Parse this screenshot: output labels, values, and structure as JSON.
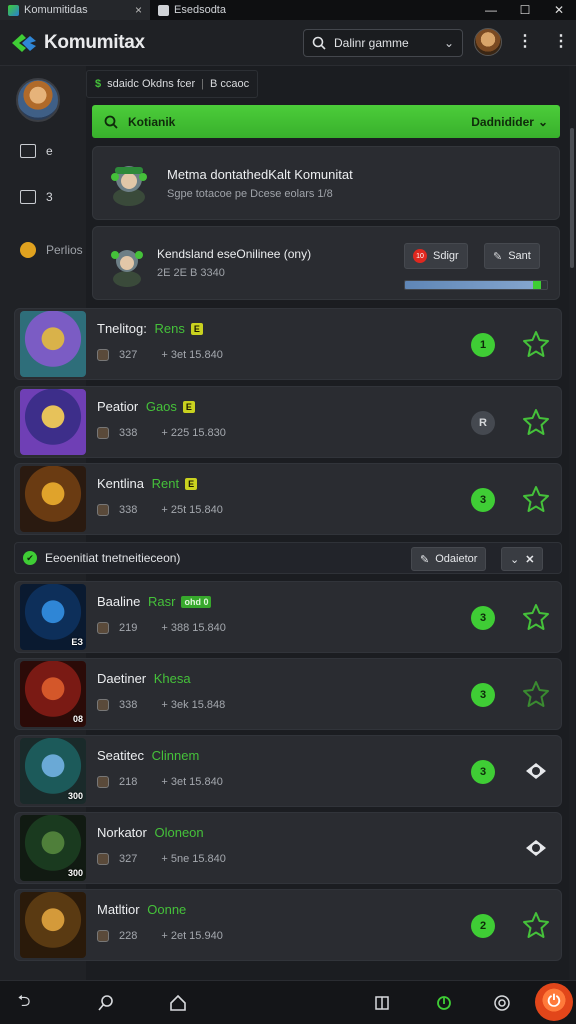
{
  "window": {
    "tab_active": "Komumitidas",
    "tab_second": "Esedsodta",
    "close_tab": "×",
    "minimize": "—",
    "maximize": "☐",
    "close": "✕"
  },
  "header": {
    "app_name": "Komumitax",
    "search_value": "Dalinr gamme",
    "search_icon": "search-icon",
    "search_chevron": "chevron-down-icon"
  },
  "rail": {
    "item1_label": "e",
    "item2_label": "3",
    "item3_label": "Perlios"
  },
  "breadcrumb": {
    "icon_text": "$",
    "text": "sdaidc Okdns fcer",
    "sep": "|",
    "tail": "B  ccaoc"
  },
  "greenbar": {
    "left": "Kotianik",
    "right": "Dadnidider",
    "right_chevron": "⌄"
  },
  "community_card": {
    "title": "Metma dontathedKalt Komunitat",
    "subtitle": "Sgpe totacoe pe Dcese eolars 1/8"
  },
  "download_card": {
    "title": "Kendsland eseOnilinee (ony)",
    "meta": "2E 2E B 3340",
    "btn_start_icon": "10",
    "btn_start": "Sdigr",
    "btn_edit": "Sant",
    "progress": 0.96
  },
  "colors": {
    "accent": "#45c13a",
    "tag_yellow": "#c9d21f",
    "fab": "#e2461a"
  },
  "games_top": [
    {
      "title": "Tnelitog:",
      "accent": "Rens",
      "tag": "E",
      "meta1": "327",
      "meta2": "+ 3et 15.840",
      "status": "1",
      "status_style": "green"
    },
    {
      "title": "Peatior",
      "accent": "Gaos",
      "tag": "E",
      "meta1": "338",
      "meta2": "+ 225 15.830",
      "status": "R",
      "status_style": "grey"
    },
    {
      "title": "Kentlina",
      "accent": "Rent",
      "tag": "E",
      "meta1": "338",
      "meta2": "+ 25t 15.840",
      "status": "3",
      "status_style": "green"
    }
  ],
  "section": {
    "title": "Eeoenitiat tnetneitieceon)",
    "btn1": "Odaietor",
    "btn2": "✕"
  },
  "games_bottom": [
    {
      "title": "Baaline",
      "accent": "Rasr",
      "tag": "ohd 0",
      "tag_style": "green",
      "level": "ЕЗ",
      "meta1": "219",
      "meta2": "+ 388 15.840",
      "status": "3",
      "status_style": "green",
      "star": "outline"
    },
    {
      "title": "Daetiner",
      "accent": "Khesa",
      "tag": "",
      "level": "08",
      "meta1": "338",
      "meta2": "+ 3ek 15.848",
      "status": "3",
      "status_style": "green",
      "star": "outline-dim"
    },
    {
      "title": "Seatitec",
      "accent": "Clinnem",
      "tag": "",
      "level": "300",
      "meta1": "218",
      "meta2": "+ 3et 15.840",
      "status": "3",
      "status_style": "green",
      "star": "eye"
    },
    {
      "title": "Norkator",
      "accent": "Oloneon",
      "tag": "",
      "level": "300",
      "meta1": "327",
      "meta2": "+ 5ne 15.840",
      "status": "",
      "status_style": "none",
      "star": "eye"
    },
    {
      "title": "Matltior",
      "accent": "Oonne",
      "tag": "",
      "level": "",
      "meta1": "228",
      "meta2": "+ 2et 15.940",
      "status": "2",
      "status_style": "green",
      "star": "outline"
    }
  ],
  "bottomnav": {
    "back": "back-icon",
    "search": "search-icon",
    "home": "home-icon",
    "tabs": "tabs-icon",
    "power": "power-icon",
    "settings": "settings-icon"
  }
}
